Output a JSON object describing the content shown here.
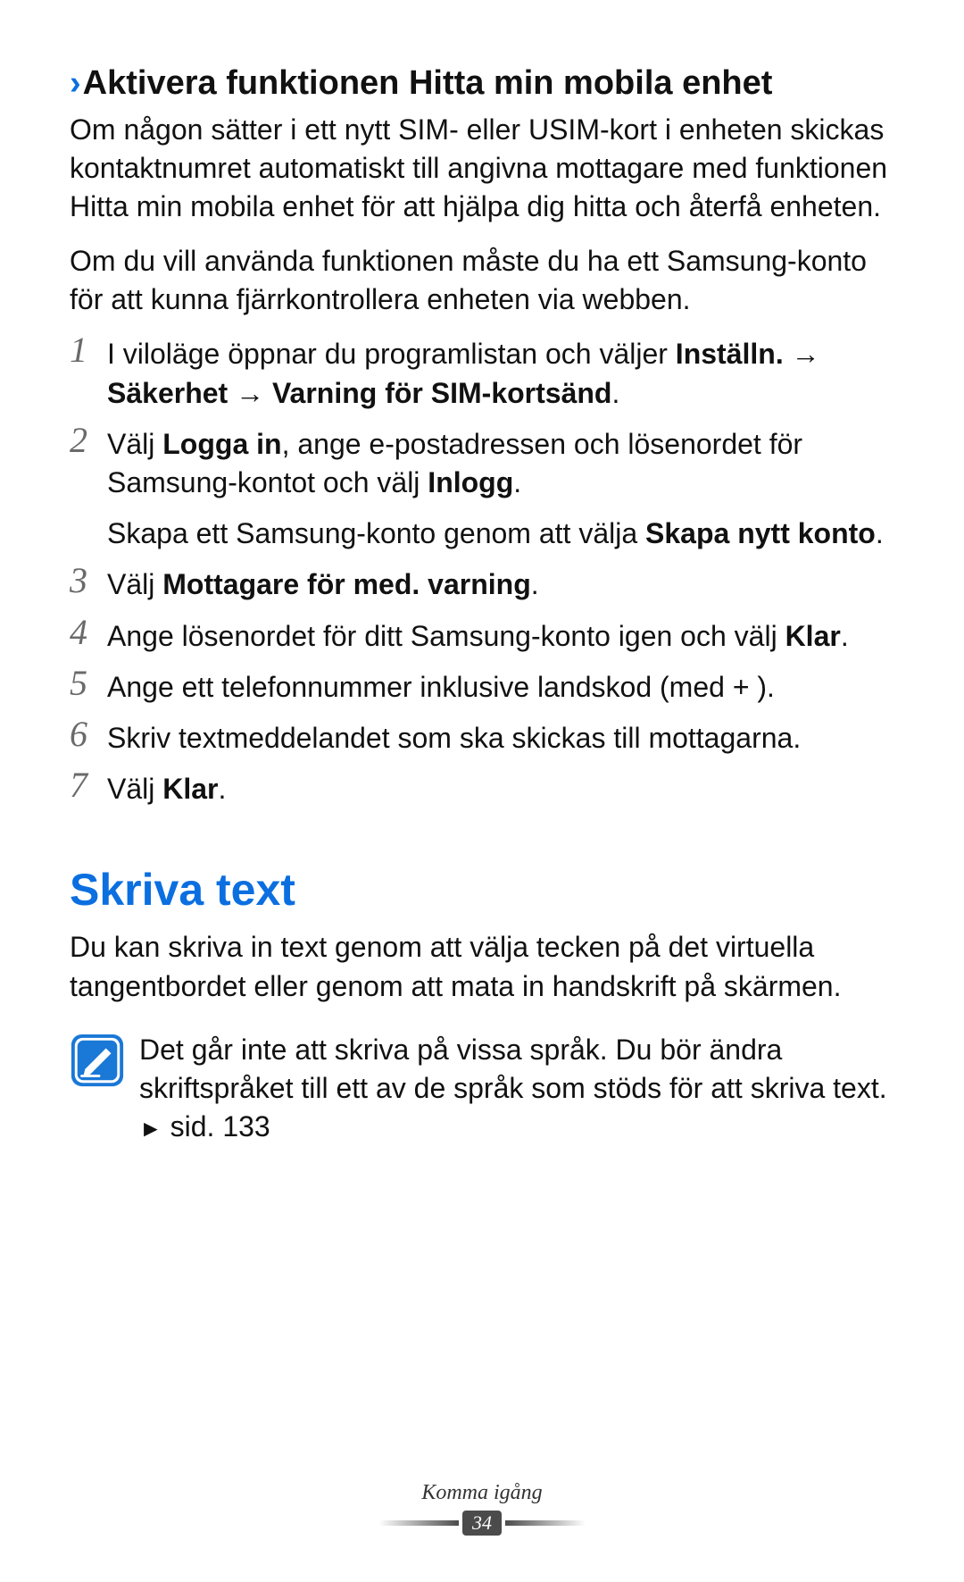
{
  "section1": {
    "heading": "Aktivera funktionen Hitta min mobila enhet",
    "para1": "Om någon sätter i ett nytt SIM- eller USIM-kort i enheten skickas kontaktnumret automatiskt till angivna mottagare med funktionen Hitta min mobila enhet för att hjälpa dig hitta och återfå enheten.",
    "para2": "Om du vill använda funktionen måste du ha ett Samsung-konto för att kunna fjärrkontrollera enheten via webben."
  },
  "steps": {
    "n1": "1",
    "s1_a": "I viloläge öppnar du programlistan och väljer ",
    "s1_b": "Inställn.",
    "s1_c": " → ",
    "s1_d": "Säkerhet",
    "s1_e": " → ",
    "s1_f": "Varning för SIM-kortsänd",
    "s1_g": ".",
    "n2": "2",
    "s2_a": "Välj ",
    "s2_b": "Logga in",
    "s2_c": ", ange e-postadressen och lösenordet för Samsung-kontot och välj ",
    "s2_d": "Inlogg",
    "s2_e": ".",
    "s2_extra_a": "Skapa ett Samsung-konto genom att välja ",
    "s2_extra_b": "Skapa nytt konto",
    "s2_extra_c": ".",
    "n3": "3",
    "s3_a": "Välj ",
    "s3_b": "Mottagare för med. varning",
    "s3_c": ".",
    "n4": "4",
    "s4_a": "Ange lösenordet för ditt Samsung-konto igen och välj ",
    "s4_b": "Klar",
    "s4_c": ".",
    "n5": "5",
    "s5": "Ange ett telefonnummer inklusive landskod (med + ).",
    "n6": "6",
    "s6": "Skriv textmeddelandet som ska skickas till mottagarna.",
    "n7": "7",
    "s7_a": "Välj ",
    "s7_b": "Klar",
    "s7_c": "."
  },
  "section2": {
    "title": "Skriva text",
    "para": "Du kan skriva in text genom att välja tecken på det virtuella tangentbordet eller genom att mata in handskrift på skärmen.",
    "note_a": "Det går inte att skriva på vissa språk. Du bör ändra skriftspråket till ett av de språk som stöds för att skriva text. ",
    "note_b": " sid. 133"
  },
  "footer": {
    "label": "Komma igång",
    "page": "34"
  }
}
